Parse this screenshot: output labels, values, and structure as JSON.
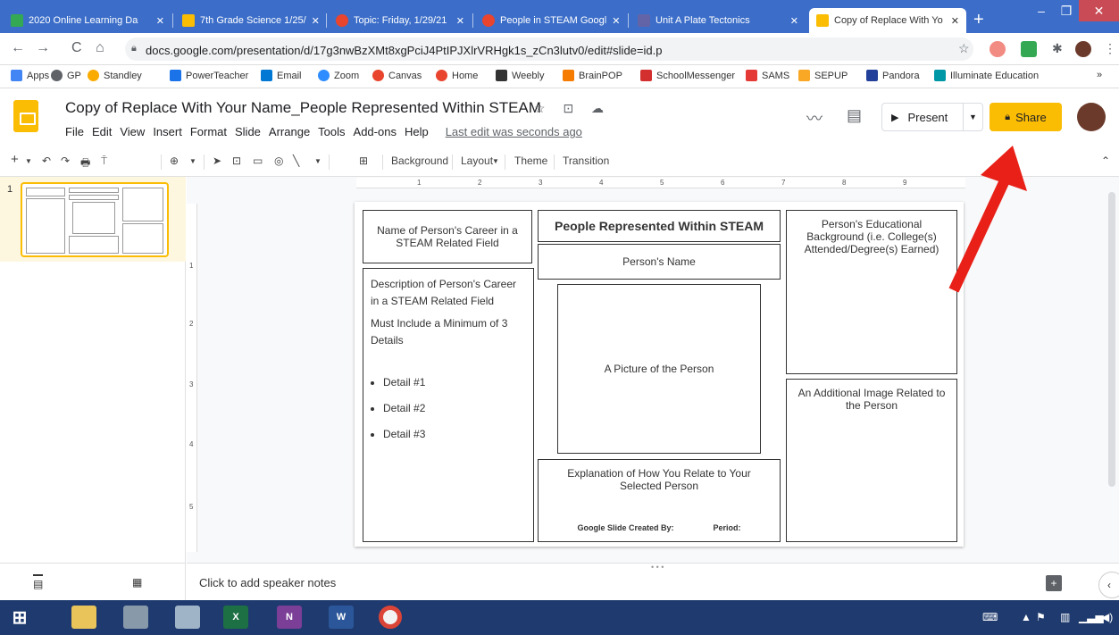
{
  "browser": {
    "tabs": [
      {
        "label": "2020 Online Learning Da",
        "color": "#34a853"
      },
      {
        "label": "7th Grade Science 1/25/",
        "color": "#fbbc04"
      },
      {
        "label": "Topic: Friday, 1/29/21",
        "color": "#e8442e"
      },
      {
        "label": "People in STEAM Googl",
        "color": "#e8442e"
      },
      {
        "label": "Unit A Plate Tectonics",
        "color": "#6264a7"
      },
      {
        "label": "Copy of Replace With Yo",
        "color": "#fbbc04"
      }
    ],
    "new_tab": "+",
    "url": "docs.google.com/presentation/d/17g3nwBzXMt8xgPciJ4PtIPJXlrVRHgk1s_zCn3lutv0/edit#slide=id.p",
    "bookmarks": [
      {
        "label": "Apps",
        "color": "#4285f4"
      },
      {
        "label": "GP",
        "color": "#5f6368"
      },
      {
        "label": "Standley",
        "color": "#f9ab00"
      },
      {
        "label": "PowerTeacher",
        "color": "#1a73e8"
      },
      {
        "label": "Email",
        "color": "#0078d4"
      },
      {
        "label": "Zoom",
        "color": "#2d8cff"
      },
      {
        "label": "Canvas",
        "color": "#e8442e"
      },
      {
        "label": "Home",
        "color": "#e8442e"
      },
      {
        "label": "Weebly",
        "color": "#333333"
      },
      {
        "label": "BrainPOP",
        "color": "#f57c00"
      },
      {
        "label": "SchoolMessenger",
        "color": "#d32f2f"
      },
      {
        "label": "SAMS",
        "color": "#e53935"
      },
      {
        "label": "SEPUP",
        "color": "#f9a825"
      },
      {
        "label": "Pandora",
        "color": "#224099"
      },
      {
        "label": "Illuminate Education",
        "color": "#0097a7"
      }
    ],
    "more_bookmarks": "»"
  },
  "slides": {
    "doc_title": "Copy of Replace With Your Name_People Represented Within STEAM",
    "title_icons": "☆ ⊡ ☁",
    "menu": [
      "File",
      "Edit",
      "View",
      "Insert",
      "Format",
      "Slide",
      "Arrange",
      "Tools",
      "Add-ons",
      "Help"
    ],
    "last_edit": "Last edit was seconds ago",
    "present": "Present",
    "share": "Share",
    "share_icon": "lock-icon",
    "toolbar": {
      "background": "Background",
      "layout": "Layout",
      "theme": "Theme",
      "transition": "Transition"
    },
    "slide_number": "1",
    "ruler_h": [
      "1",
      "2",
      "3",
      "4",
      "5",
      "6",
      "7",
      "8",
      "9"
    ],
    "ruler_v": [
      "1",
      "2",
      "3",
      "4",
      "5"
    ],
    "speaker_notes_placeholder": "Click to add speaker notes",
    "notes_handle": "• • •"
  },
  "slide": {
    "career_name": "Name of Person's Career in a STEAM Related Field",
    "main_title": "People Represented Within STEAM",
    "person_name": "Person's Name",
    "education": "Person's Educational Background (i.e. College(s) Attended/Degree(s) Earned)",
    "description": "Description of Person's Career in a STEAM Related Field",
    "min_details": "Must Include a Minimum of 3 Details",
    "details": [
      "Detail #1",
      "Detail #2",
      "Detail #3"
    ],
    "picture": "A Picture of the Person",
    "additional_image": "An Additional Image Related to the Person",
    "explanation": "Explanation of How You Relate to Your Selected Person",
    "created_by": "Google Slide Created By:",
    "period": "Period:"
  },
  "colors": {
    "tabstrip": "#3c6ec9",
    "share": "#fbbc04",
    "arrow": "#e82018",
    "taskbar": "#1e3a6e"
  }
}
